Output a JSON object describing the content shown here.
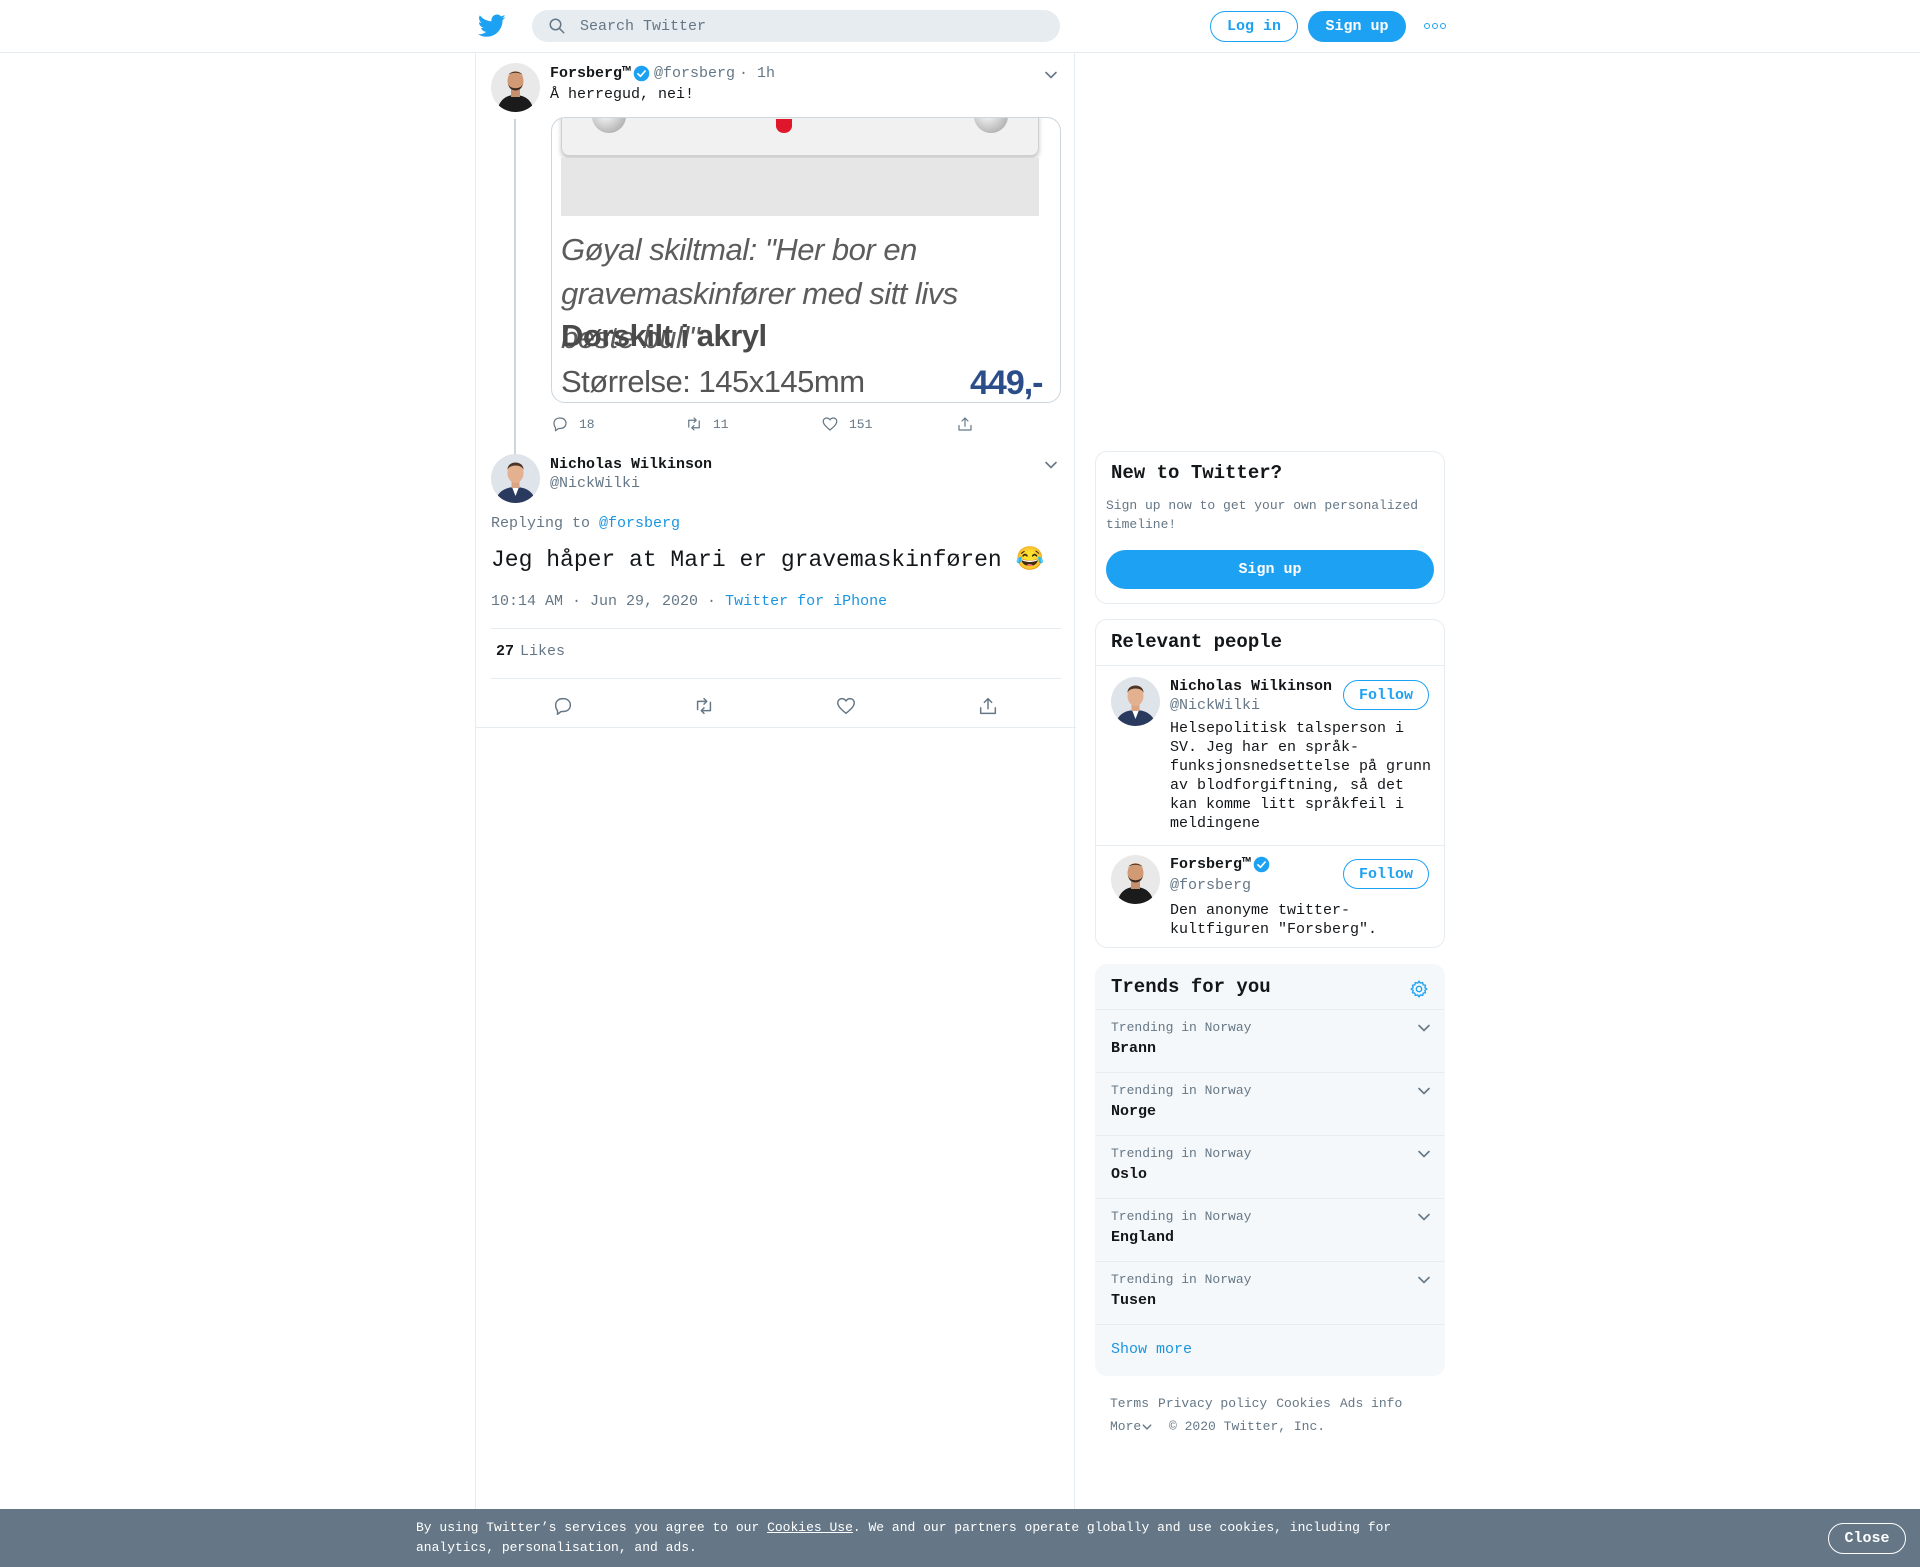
{
  "topbar": {
    "search_placeholder": "Search Twitter",
    "login_label": "Log in",
    "signup_label": "Sign up"
  },
  "parent_tweet": {
    "name": "Forsberg™",
    "handle": "@forsberg",
    "time": "· 1h",
    "text": "Å herregud, nei!",
    "media": {
      "caption_line1": "Gøyal skiltmal: \"Her bor en gravemaskinfører med sitt livs beste bull\"",
      "caption_line2": "Dørskilt i akryl",
      "caption_size": "Størrelse: 145x145mm",
      "price": "449,-"
    },
    "replies": "18",
    "retweets": "11",
    "likes": "151"
  },
  "focused_tweet": {
    "name": "Nicholas Wilkinson",
    "handle": "@NickWilki",
    "replying_label": "Replying to",
    "replying_to": "@forsberg",
    "text": "Jeg håper at Mari er gravemaskinføren 😂",
    "timestamp": "10:14 AM · Jun 29, 2020",
    "separator": " · ",
    "source": "Twitter for iPhone",
    "likes_count": "27",
    "likes_label": "Likes"
  },
  "new_to_twitter": {
    "title": "New to Twitter?",
    "subtitle": "Sign up now to get your own personalized timeline!",
    "button": "Sign up"
  },
  "relevant_people": {
    "title": "Relevant people",
    "follow_label": "Follow",
    "people": [
      {
        "name": "Nicholas Wilkinson",
        "handle": "@NickWilki",
        "bio": "Helsepolitisk talsperson i SV. Jeg har en språk-funksjonsnedsettelse på grunn av blodforgiftning, så det kan komme litt språkfeil i meldingene"
      },
      {
        "name": "Forsberg™",
        "handle": "@forsberg",
        "bio": "Den anonyme twitter-kultfiguren \"Forsberg\"."
      }
    ]
  },
  "trends": {
    "title": "Trends for you",
    "items": [
      {
        "context": "Trending in Norway",
        "name": "Brann"
      },
      {
        "context": "Trending in Norway",
        "name": "Norge"
      },
      {
        "context": "Trending in Norway",
        "name": "Oslo"
      },
      {
        "context": "Trending in Norway",
        "name": "England"
      },
      {
        "context": "Trending in Norway",
        "name": "Tusen"
      }
    ],
    "show_more": "Show more"
  },
  "footer": {
    "links": [
      "Terms",
      "Privacy policy",
      "Cookies",
      "Ads info"
    ],
    "more": "More",
    "copyright": "© 2020 Twitter, Inc."
  },
  "cookie_bar": {
    "text_before": "By using Twitter’s services you agree to our ",
    "link": "Cookies Use",
    "text_after": ". We and our partners operate globally and use cookies, including for analytics, personalisation, and ads.",
    "close": "Close"
  },
  "colors": {
    "accent": "#1da1f2",
    "link": "#1b95e0",
    "secondary_text": "#657786",
    "border": "#e6ecf0",
    "cookie_bg": "#657786"
  }
}
